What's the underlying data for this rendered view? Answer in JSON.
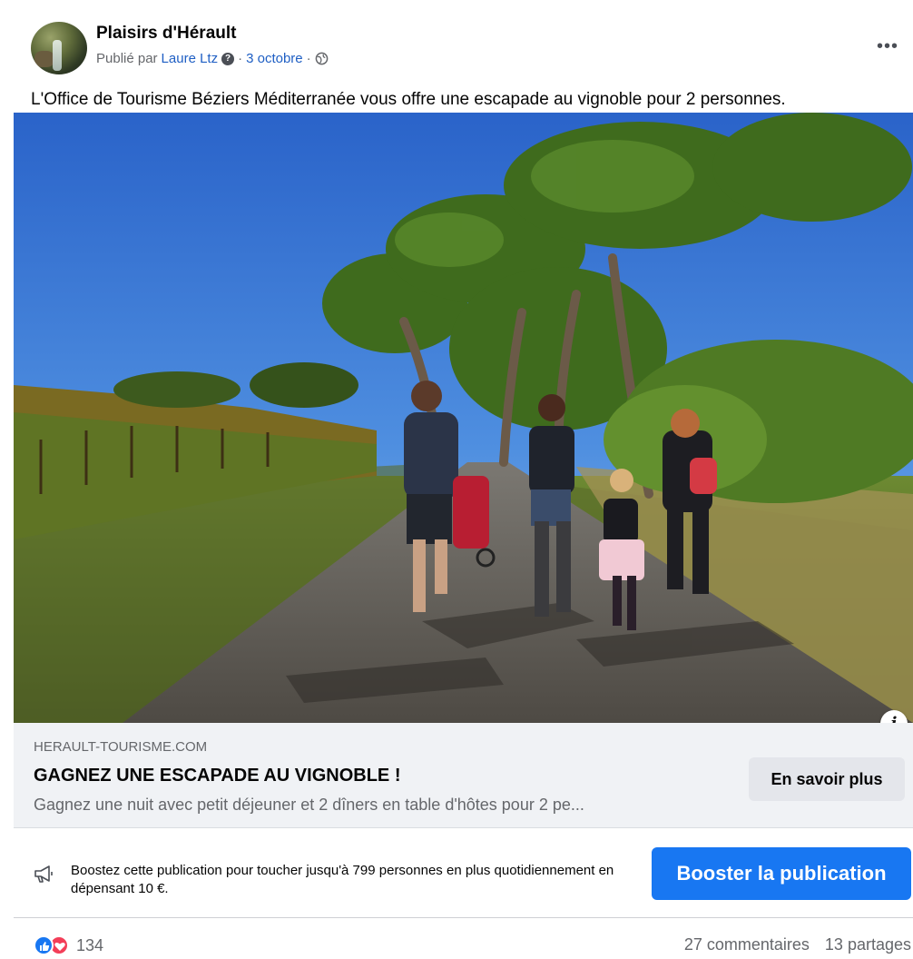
{
  "post": {
    "page_name": "Plaisirs d'Hérault",
    "published_by_prefix": "Publié par",
    "author": "Laure Ltz",
    "date": "3 octobre",
    "separator": "·",
    "more_label": "•••",
    "caption": "L'Office de Tourisme Béziers Méditerranée vous offre une escapade au vignoble pour 2 personnes."
  },
  "link_card": {
    "domain": "HERAULT-TOURISME.COM",
    "title": "GAGNEZ UNE ESCAPADE AU VIGNOBLE !",
    "description": "Gagnez une nuit avec petit déjeuner et 2 dîners en table d'hôtes pour 2 pe...",
    "cta_label": "En savoir plus",
    "info_label": "i"
  },
  "boost": {
    "text": "Boostez cette publication pour toucher jusqu'à 799 personnes en plus quotidiennement en dépensant 10 €.",
    "button_label": "Booster la publication",
    "button_color": "#1877f2"
  },
  "engagement": {
    "reaction_count": "134",
    "comments": "27 commentaires",
    "shares": "13 partages"
  },
  "icons": {
    "avatar": "waterfall-avatar",
    "help": "question-circle-icon",
    "audience": "globe-icon",
    "more": "ellipsis-icon",
    "info": "info-icon",
    "boost": "megaphone-icon",
    "reactions": [
      "like-icon",
      "love-icon"
    ]
  },
  "colors": {
    "link": "#1f5fc4",
    "muted": "#65676b",
    "like": "#1877f2",
    "love": "#f33e58",
    "card_bg": "#f0f2f5"
  }
}
